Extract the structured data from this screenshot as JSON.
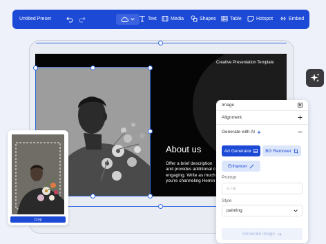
{
  "toolbar": {
    "title": "Untitled Preser",
    "undo_icon": "undo-icon",
    "redo_icon": "redo-icon",
    "cloud_icon": "cloud-icon",
    "items": [
      {
        "label": "Text",
        "icon": "text-icon"
      },
      {
        "label": "Media",
        "icon": "media-icon"
      },
      {
        "label": "Shapes",
        "icon": "shapes-icon"
      },
      {
        "label": "Table",
        "icon": "table-icon"
      },
      {
        "label": "Hotspot",
        "icon": "hotspot-icon"
      },
      {
        "label": "Embed",
        "icon": "embed-icon"
      }
    ],
    "colors": {
      "bar": "#1c4ad6"
    }
  },
  "slide": {
    "header": "Creative Presentation Template",
    "heading": "About us",
    "body_lines": [
      "Offer a brief description",
      "and provides additional c",
      "engaging. Write as much",
      "you're channeling Hemin"
    ]
  },
  "crop": {
    "button_label": "Crop"
  },
  "panel": {
    "title": "Image",
    "alignment_label": "Alignment",
    "generate_label": "Generate with AI",
    "art_generator_label": "Art Generator",
    "bg_remover_label": "BG Remover",
    "enhancer_label": "Enhancer",
    "prompt_label": "Prompt",
    "prompt_placeholder": "a cat",
    "style_label": "Style",
    "style_value": "painting",
    "generate_button": "Generate Image",
    "colors": {
      "primary": "#1c4ad6",
      "secondary_bg": "#dce6fb",
      "disabled_bg": "#eef2fb"
    }
  },
  "ai_sparkle_icon": "sparkle-icon"
}
